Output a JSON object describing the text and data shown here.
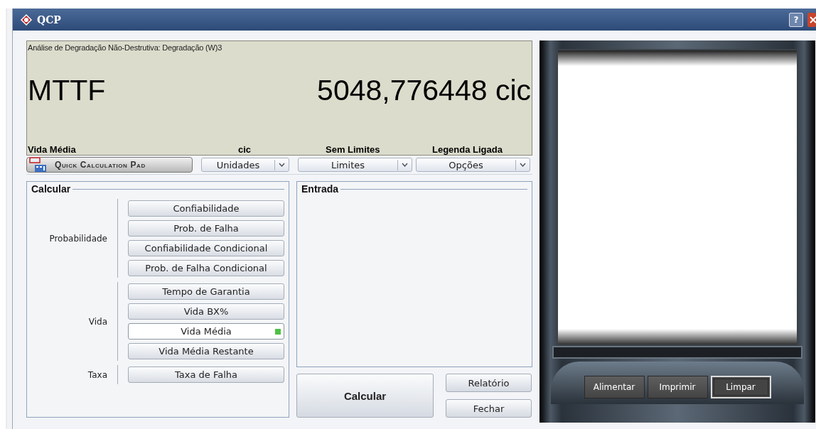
{
  "window": {
    "title": "QCP",
    "help_button": "?"
  },
  "display": {
    "analysis": "Análise de Degradação Não-Destrutiva: Degradação (W)3",
    "quantity": "MTTF",
    "result": "5048,776448 cic",
    "labels": [
      "Vida Média",
      "cic",
      "Sem Limites",
      "Legenda Ligada"
    ]
  },
  "toolbar": {
    "pad_button": "Quick Calculation Pad",
    "dropdowns": [
      "Unidades",
      "Limites",
      "Opções"
    ]
  },
  "calcular": {
    "title": "Calcular",
    "groups": [
      {
        "label": "Probabilidade",
        "buttons": [
          {
            "label": "Confiabilidade",
            "selected": false
          },
          {
            "label": "Prob. de Falha",
            "selected": false
          },
          {
            "label": "Confiabilidade Condicional",
            "selected": false
          },
          {
            "label": "Prob. de Falha Condicional",
            "selected": false
          }
        ]
      },
      {
        "label": "Vida",
        "buttons": [
          {
            "label": "Tempo de Garantia",
            "selected": false
          },
          {
            "label": "Vida BX%",
            "selected": false
          },
          {
            "label": "Vida Média",
            "selected": true
          },
          {
            "label": "Vida Média Restante",
            "selected": false
          }
        ]
      },
      {
        "label": "Taxa",
        "buttons": [
          {
            "label": "Taxa de Falha",
            "selected": false
          }
        ]
      }
    ]
  },
  "entrada": {
    "title": "Entrada"
  },
  "actions": {
    "calculate": "Calcular",
    "report": "Relatório",
    "close": "Fechar"
  },
  "printer": {
    "buttons": [
      {
        "label": "Alimentar",
        "focused": false
      },
      {
        "label": "Imprimir",
        "focused": false
      },
      {
        "label": "Limpar",
        "focused": true
      }
    ]
  }
}
